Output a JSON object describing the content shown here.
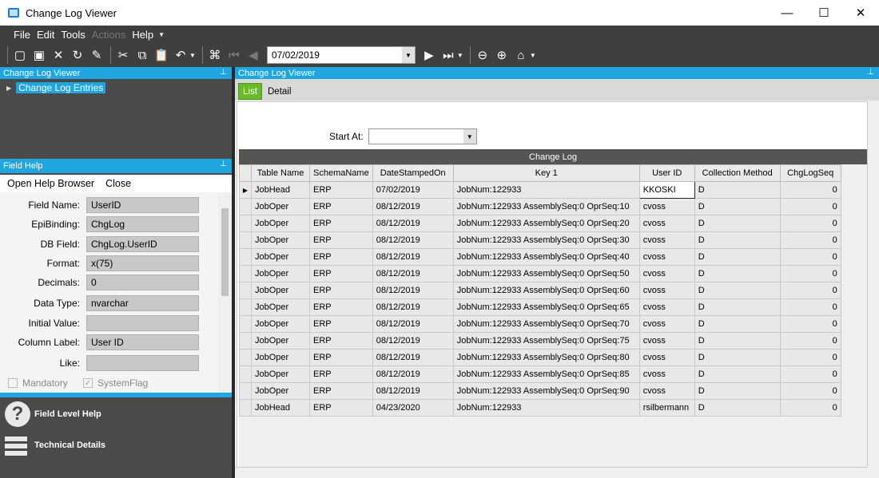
{
  "window": {
    "title": "Change Log Viewer",
    "minimize": "—",
    "maximize": "☐",
    "close": "✕"
  },
  "menu": {
    "items": [
      "File",
      "Edit",
      "Tools",
      "Actions",
      "Help"
    ]
  },
  "toolbar": {
    "date": "07/02/2019"
  },
  "navpanel": {
    "title": "Change Log Viewer",
    "tree_item": "Change Log Entries"
  },
  "fieldhelp": {
    "title": "Field Help",
    "open_browser": "Open Help Browser",
    "close": "Close",
    "rows": [
      {
        "label": "Field Name:",
        "value": "UserID"
      },
      {
        "label": "EpiBinding:",
        "value": "ChgLog"
      },
      {
        "label": "DB Field:",
        "value": "ChgLog.UserID"
      },
      {
        "label": "Format:",
        "value": "x(75)"
      },
      {
        "label": "Decimals:",
        "value": "0"
      },
      {
        "label": "Data Type:",
        "value": "nvarchar"
      },
      {
        "label": "Initial Value:",
        "value": ""
      },
      {
        "label": "Column Label:",
        "value": "User ID"
      },
      {
        "label": "Like:",
        "value": ""
      }
    ],
    "mandatory": "Mandatory",
    "systemflag": "SystemFlag"
  },
  "bottompanel": {
    "field_level_help": "Field Level Help",
    "technical_details": "Technical Details"
  },
  "main": {
    "title": "Change Log Viewer",
    "tabs": [
      "List",
      "Detail"
    ],
    "start_at_label": "Start At:",
    "grid_title": "Change Log",
    "columns": [
      "Table Name",
      "SchemaName",
      "DateStampedOn",
      "Key 1",
      "User ID",
      "Collection Method",
      "ChgLogSeq"
    ],
    "rows": [
      [
        "JobHead",
        "ERP",
        "07/02/2019",
        "JobNum:122933",
        "KKOSKI",
        "D",
        "0"
      ],
      [
        "JobOper",
        "ERP",
        "08/12/2019",
        "JobNum:122933 AssemblySeq:0 OprSeq:10",
        "cvoss",
        "D",
        "0"
      ],
      [
        "JobOper",
        "ERP",
        "08/12/2019",
        "JobNum:122933 AssemblySeq:0 OprSeq:20",
        "cvoss",
        "D",
        "0"
      ],
      [
        "JobOper",
        "ERP",
        "08/12/2019",
        "JobNum:122933 AssemblySeq:0 OprSeq:30",
        "cvoss",
        "D",
        "0"
      ],
      [
        "JobOper",
        "ERP",
        "08/12/2019",
        "JobNum:122933 AssemblySeq:0 OprSeq:40",
        "cvoss",
        "D",
        "0"
      ],
      [
        "JobOper",
        "ERP",
        "08/12/2019",
        "JobNum:122933 AssemblySeq:0 OprSeq:50",
        "cvoss",
        "D",
        "0"
      ],
      [
        "JobOper",
        "ERP",
        "08/12/2019",
        "JobNum:122933 AssemblySeq:0 OprSeq:60",
        "cvoss",
        "D",
        "0"
      ],
      [
        "JobOper",
        "ERP",
        "08/12/2019",
        "JobNum:122933 AssemblySeq:0 OprSeq:65",
        "cvoss",
        "D",
        "0"
      ],
      [
        "JobOper",
        "ERP",
        "08/12/2019",
        "JobNum:122933 AssemblySeq:0 OprSeq:70",
        "cvoss",
        "D",
        "0"
      ],
      [
        "JobOper",
        "ERP",
        "08/12/2019",
        "JobNum:122933 AssemblySeq:0 OprSeq:75",
        "cvoss",
        "D",
        "0"
      ],
      [
        "JobOper",
        "ERP",
        "08/12/2019",
        "JobNum:122933 AssemblySeq:0 OprSeq:80",
        "cvoss",
        "D",
        "0"
      ],
      [
        "JobOper",
        "ERP",
        "08/12/2019",
        "JobNum:122933 AssemblySeq:0 OprSeq:85",
        "cvoss",
        "D",
        "0"
      ],
      [
        "JobOper",
        "ERP",
        "08/12/2019",
        "JobNum:122933 AssemblySeq:0 OprSeq:90",
        "cvoss",
        "D",
        "0"
      ],
      [
        "JobHead",
        "ERP",
        "04/23/2020",
        "JobNum:122933",
        "rsilbermann",
        "D",
        "0"
      ]
    ]
  }
}
